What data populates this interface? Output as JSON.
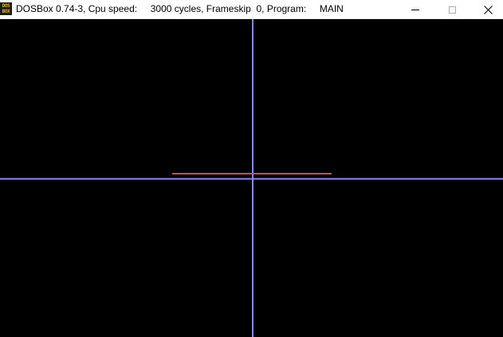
{
  "window": {
    "title": "DOSBox 0.74-3, Cpu speed:     3000 cycles, Frameskip  0, Program:     MAIN",
    "icon": "dosbox-icon",
    "icon_text": "DOS BOX",
    "controls": {
      "minimize": "minimize-icon",
      "maximize": "maximize-icon",
      "close": "close-icon"
    }
  },
  "screen": {
    "background": "#000000",
    "axis_color": "#8888ff",
    "segment_color": "#e04848"
  }
}
